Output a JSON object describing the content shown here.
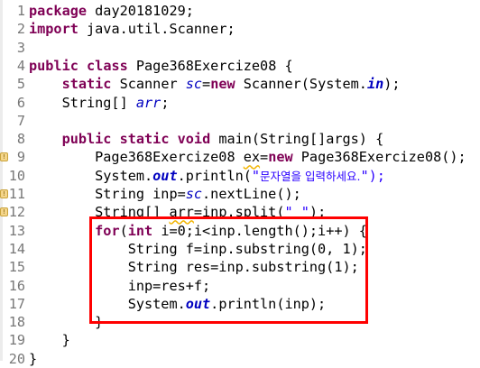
{
  "editor": {
    "lines": [
      {
        "n": "1",
        "segs": [
          {
            "t": "package",
            "c": "kw"
          },
          {
            "t": " day20181029;"
          }
        ]
      },
      {
        "n": "2",
        "segs": [
          {
            "t": "import",
            "c": "kw"
          },
          {
            "t": " java.util.Scanner;"
          }
        ]
      },
      {
        "n": "3",
        "segs": []
      },
      {
        "n": "4",
        "segs": [
          {
            "t": "public",
            "c": "kw"
          },
          {
            "t": " "
          },
          {
            "t": "class",
            "c": "kw"
          },
          {
            "t": " Page368Exercize08 {"
          }
        ]
      },
      {
        "n": "5",
        "segs": [
          {
            "t": "    "
          },
          {
            "t": "static",
            "c": "kw"
          },
          {
            "t": " Scanner "
          },
          {
            "t": "sc",
            "c": "fld"
          },
          {
            "t": "="
          },
          {
            "t": "new",
            "c": "kw"
          },
          {
            "t": " Scanner(System."
          },
          {
            "t": "in",
            "c": "sfld"
          },
          {
            "t": ");"
          }
        ]
      },
      {
        "n": "6",
        "segs": [
          {
            "t": "    String[] "
          },
          {
            "t": "arr",
            "c": "fld"
          },
          {
            "t": ";"
          }
        ]
      },
      {
        "n": "7",
        "segs": []
      },
      {
        "n": "8",
        "segs": [
          {
            "t": "    "
          },
          {
            "t": "public",
            "c": "kw"
          },
          {
            "t": " "
          },
          {
            "t": "static",
            "c": "kw"
          },
          {
            "t": " "
          },
          {
            "t": "void",
            "c": "kw"
          },
          {
            "t": " main(String[]args) {"
          }
        ]
      },
      {
        "n": "9",
        "marker": true,
        "segs": [
          {
            "t": "        Page368Exercize08 "
          },
          {
            "t": "ex",
            "c": "warn"
          },
          {
            "t": "="
          },
          {
            "t": "new",
            "c": "kw"
          },
          {
            "t": " Page368Exercize08();"
          }
        ]
      },
      {
        "n": "10",
        "segs": [
          {
            "t": "        System."
          },
          {
            "t": "out",
            "c": "sfld"
          },
          {
            "t": ".println("
          },
          {
            "t": "\"",
            "c": "str"
          },
          {
            "t": "문자열을 입력하세요.",
            "c": "str kor"
          },
          {
            "t": "\");",
            "c": "str"
          }
        ]
      },
      {
        "n": "11",
        "marker": true,
        "segs": [
          {
            "t": "        String inp="
          },
          {
            "t": "sc",
            "c": "fld"
          },
          {
            "t": ".nextLine();"
          }
        ]
      },
      {
        "n": "12",
        "marker": true,
        "segs": [
          {
            "t": "        String[] "
          },
          {
            "t": "arr",
            "c": "warn"
          },
          {
            "t": "=inp.split("
          },
          {
            "t": "\" \"",
            "c": "str"
          },
          {
            "t": ");"
          }
        ]
      },
      {
        "n": "13",
        "segs": [
          {
            "t": "        "
          },
          {
            "t": "for",
            "c": "kw"
          },
          {
            "t": "("
          },
          {
            "t": "int",
            "c": "kw"
          },
          {
            "t": " i=0;i<inp.length();i++) {"
          }
        ]
      },
      {
        "n": "14",
        "segs": [
          {
            "t": "            String f=inp.substring(0, 1);"
          }
        ]
      },
      {
        "n": "15",
        "segs": [
          {
            "t": "            String res=inp.substring(1);"
          }
        ]
      },
      {
        "n": "16",
        "segs": [
          {
            "t": "            inp=res+f;"
          }
        ]
      },
      {
        "n": "17",
        "segs": [
          {
            "t": "            System."
          },
          {
            "t": "out",
            "c": "sfld"
          },
          {
            "t": ".println(inp);"
          }
        ]
      },
      {
        "n": "18",
        "segs": [
          {
            "t": "        }"
          }
        ]
      },
      {
        "n": "19",
        "segs": [
          {
            "t": "    }"
          }
        ]
      },
      {
        "n": "20",
        "segs": [
          {
            "t": "}"
          }
        ]
      }
    ]
  },
  "marker_icon": "warning-marker-icon",
  "highlight_color": "#ff0000"
}
